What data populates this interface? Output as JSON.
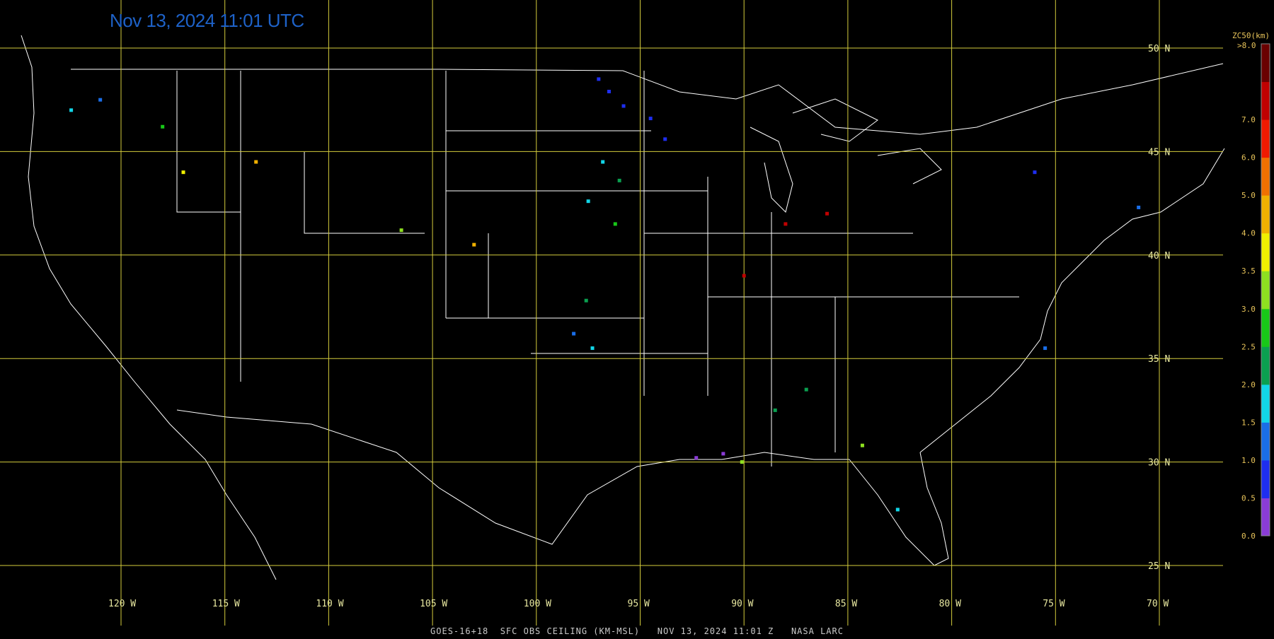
{
  "header": {
    "timestamp": "Nov 13, 2024 11:01 UTC"
  },
  "footer": {
    "caption": "GOES-16+18  SFC OBS CEILING (KM-MSL)   NOV 13, 2024 11:01 Z   NASA LARC"
  },
  "map": {
    "lon_range": [
      -125,
      -70
    ],
    "lat_range": [
      23,
      51
    ],
    "grid_color": "#d4cc3c",
    "boundary_color": "#ffffff",
    "longitude_labels": [
      "120W",
      "115W",
      "110W",
      "105W",
      "100W",
      "95W",
      "90W",
      "85W",
      "80W",
      "75W",
      "70W"
    ],
    "latitude_labels": [
      "50N",
      "45N",
      "40N",
      "35N",
      "30N",
      "25N"
    ]
  },
  "colorbar": {
    "title": "ZC50(km)",
    "top_label": ">8.0",
    "tick_labels": [
      "0.0",
      "0.5",
      "1.0",
      "1.5",
      "2.0",
      "2.5",
      "3.0",
      "3.5",
      "4.0",
      "5.0",
      "6.0",
      "7.0"
    ],
    "colors": [
      "#8a3cd6",
      "#1e2ef0",
      "#1a6ee8",
      "#12d6e8",
      "#0aa050",
      "#18c818",
      "#8ee020",
      "#f0f000",
      "#f0b000",
      "#f07000",
      "#f01a00",
      "#c00000",
      "#6a0000"
    ]
  },
  "observations_km": [
    {
      "lon": -97.0,
      "lat": 48.5,
      "ceiling_km": 0.6
    },
    {
      "lon": -96.5,
      "lat": 47.9,
      "ceiling_km": 0.7
    },
    {
      "lon": -95.8,
      "lat": 47.2,
      "ceiling_km": 0.6
    },
    {
      "lon": -94.5,
      "lat": 46.6,
      "ceiling_km": 0.7
    },
    {
      "lon": -93.8,
      "lat": 45.6,
      "ceiling_km": 0.8
    },
    {
      "lon": -96.8,
      "lat": 44.5,
      "ceiling_km": 1.8
    },
    {
      "lon": -96.0,
      "lat": 43.6,
      "ceiling_km": 2.4
    },
    {
      "lon": -97.5,
      "lat": 42.6,
      "ceiling_km": 1.8
    },
    {
      "lon": -96.2,
      "lat": 41.5,
      "ceiling_km": 2.6
    },
    {
      "lon": -97.6,
      "lat": 37.8,
      "ceiling_km": 2.2
    },
    {
      "lon": -97.3,
      "lat": 35.5,
      "ceiling_km": 1.8
    },
    {
      "lon": -98.2,
      "lat": 36.2,
      "ceiling_km": 1.4
    },
    {
      "lon": -91.0,
      "lat": 30.4,
      "ceiling_km": 0.3
    },
    {
      "lon": -92.3,
      "lat": 30.2,
      "ceiling_km": 0.2
    },
    {
      "lon": -90.1,
      "lat": 30.0,
      "ceiling_km": 3.2
    },
    {
      "lon": -88.5,
      "lat": 32.5,
      "ceiling_km": 2.2
    },
    {
      "lon": -87.0,
      "lat": 33.5,
      "ceiling_km": 2.4
    },
    {
      "lon": -84.3,
      "lat": 30.8,
      "ceiling_km": 3.4
    },
    {
      "lon": -82.6,
      "lat": 27.7,
      "ceiling_km": 1.8
    },
    {
      "lon": -121.0,
      "lat": 47.5,
      "ceiling_km": 1.4
    },
    {
      "lon": -122.4,
      "lat": 47.0,
      "ceiling_km": 1.8
    },
    {
      "lon": -118.0,
      "lat": 46.2,
      "ceiling_km": 2.6
    },
    {
      "lon": -117.0,
      "lat": 44.0,
      "ceiling_km": 3.6
    },
    {
      "lon": -113.5,
      "lat": 44.5,
      "ceiling_km": 4.1
    },
    {
      "lon": -106.5,
      "lat": 41.2,
      "ceiling_km": 3.2
    },
    {
      "lon": -103.0,
      "lat": 40.5,
      "ceiling_km": 4.1
    },
    {
      "lon": -86.0,
      "lat": 42.0,
      "ceiling_km": 7.5
    },
    {
      "lon": -88.0,
      "lat": 41.5,
      "ceiling_km": 7.3
    },
    {
      "lon": -90.0,
      "lat": 39.0,
      "ceiling_km": 7.6
    },
    {
      "lon": -76.0,
      "lat": 44.0,
      "ceiling_km": 0.6
    },
    {
      "lon": -71.0,
      "lat": 42.3,
      "ceiling_km": 1.2
    },
    {
      "lon": -75.5,
      "lat": 35.5,
      "ceiling_km": 1.4
    }
  ]
}
